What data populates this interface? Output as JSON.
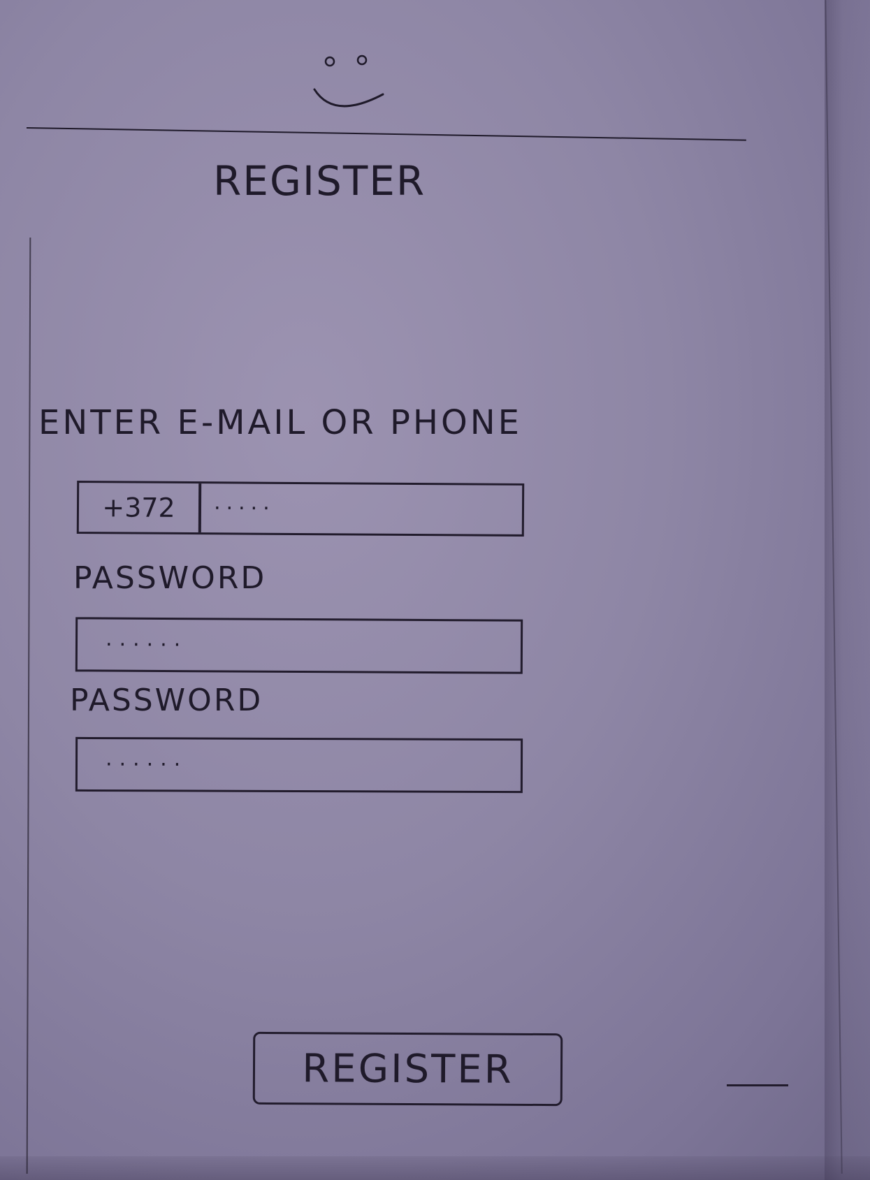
{
  "header": {
    "title": "REGISTER",
    "avatar_icon": "smiley-face-icon"
  },
  "form": {
    "identifier_label": "ENTER E-MAIL OR PHONE",
    "country_code": "+372",
    "phone_value": "·····",
    "password_label": "PASSWORD",
    "password_value": "······",
    "confirm_password_label": "PASSWORD",
    "confirm_password_value": "······"
  },
  "actions": {
    "register_label": "REGISTER"
  },
  "colors": {
    "paper": "#8e86a5",
    "ink": "#1f1a2a"
  }
}
